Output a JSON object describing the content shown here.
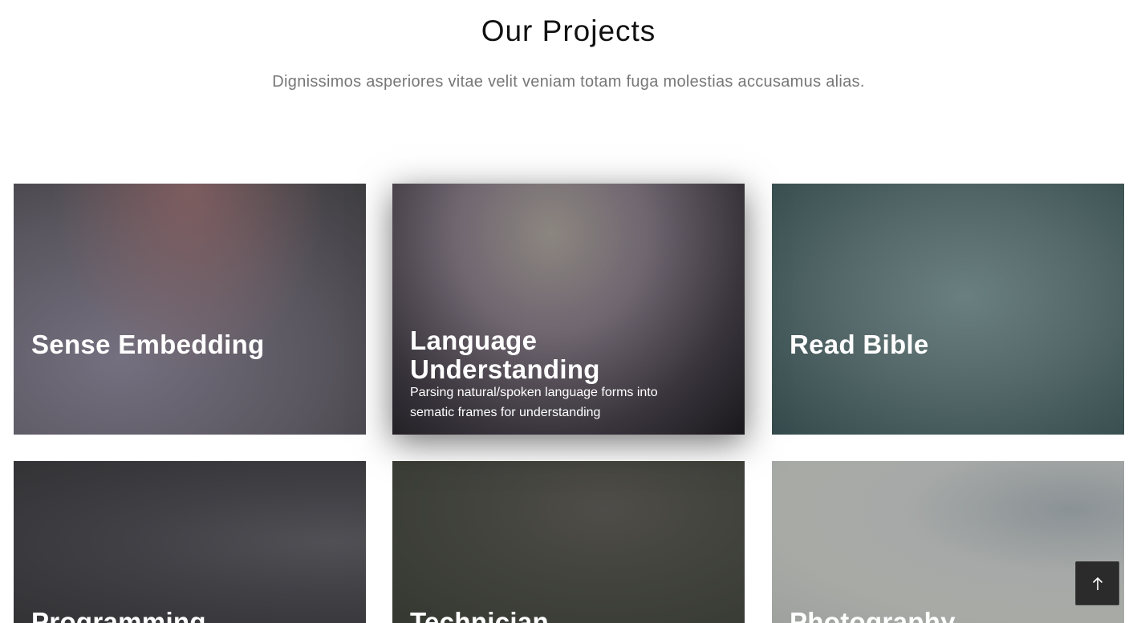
{
  "section": {
    "title": "Our Projects",
    "subtitle": "Dignissimos asperiores vitae velit veniam totam fuga molestias accusamus alias."
  },
  "projects": [
    {
      "title": "Sense Embedding",
      "description": ""
    },
    {
      "title": "Language Understanding",
      "description": "Parsing natural/spoken language forms into sematic frames for understanding"
    },
    {
      "title": "Read Bible",
      "description": ""
    },
    {
      "title": "Programming",
      "description": ""
    },
    {
      "title": "Technician",
      "description": ""
    },
    {
      "title": "Photography",
      "description": ""
    }
  ],
  "back_to_top": {
    "icon": "arrow-up-icon"
  }
}
